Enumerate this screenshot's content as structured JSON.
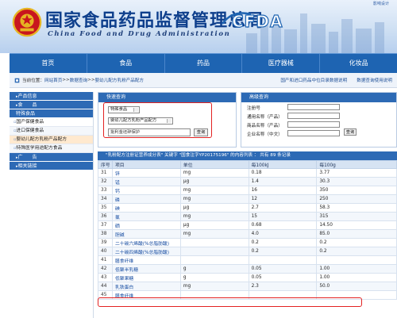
{
  "header": {
    "title_cn": "国家食品药品监督管理总局",
    "title_en": "China Food and Drug Administration",
    "logo_text": "CFDA",
    "top_link": "影响设计"
  },
  "nav": [
    "首页",
    "食品",
    "药品",
    "医疗器械",
    "化妆品"
  ],
  "breadcrumb": {
    "prefix": "当前位置：",
    "items": [
      "网站首页",
      "数据查询",
      "婴幼儿配方乳粉产品配方"
    ],
    "sep": ">>",
    "right_links": [
      "国产和进口药品中位目录数据说明",
      "数据查询使用说明"
    ]
  },
  "sidebar": {
    "sections": [
      {
        "head": "产品信息",
        "arrow": true
      },
      {
        "head": "食　　品",
        "arrow": true
      },
      {
        "head": "特殊食品",
        "arrow": false
      }
    ],
    "items": [
      "国产保健食品",
      "进口保健食品",
      "婴幼儿配方乳粉产品配方",
      "特殊医学用途配方食品"
    ],
    "active_index": 2,
    "bottom_heads": [
      "广　　告",
      "相关链接"
    ]
  },
  "search_panel": {
    "title": "快速查询",
    "select1": "特殊食品",
    "select2": "婴幼儿配方乳粉产品配方",
    "input_value": "批利金坯碎保护",
    "search_button": "查询"
  },
  "advanced_panel": {
    "title": "高级查询",
    "fields": [
      {
        "label": "注册号",
        "value": ""
      },
      {
        "label": "通用名称（产品）",
        "value": ""
      },
      {
        "label": "商品名称（产品）",
        "value": ""
      },
      {
        "label": "企业名称（中文）",
        "value": ""
      }
    ],
    "search_button": "查询"
  },
  "results": {
    "title": "\"乳粉配方注册证营养成分表\" 关键字 \"国食注字YP20175196\" 的内容列表 ：  共有 89 条记录",
    "columns": [
      "序号",
      "项目",
      "单位",
      "每100kJ",
      "每100g"
    ],
    "rows": [
      {
        "seq": "31",
        "name": "锌",
        "unit": "mg",
        "per_kj": "0.18",
        "per_g": "3.77"
      },
      {
        "seq": "32",
        "name": "锰",
        "unit": "μg",
        "per_kj": "1.4",
        "per_g": "30.3"
      },
      {
        "seq": "33",
        "name": "钙",
        "unit": "mg",
        "per_kj": "16",
        "per_g": "350"
      },
      {
        "seq": "34",
        "name": "磷",
        "unit": "mg",
        "per_kj": "12",
        "per_g": "250"
      },
      {
        "seq": "35",
        "name": "碘",
        "unit": "μg",
        "per_kj": "2.7",
        "per_g": "58.3"
      },
      {
        "seq": "36",
        "name": "氯",
        "unit": "mg",
        "per_kj": "15",
        "per_g": "315"
      },
      {
        "seq": "37",
        "name": "硒",
        "unit": "μg",
        "per_kj": "0.68",
        "per_g": "14.50"
      },
      {
        "seq": "38",
        "name": "胆碱",
        "unit": "mg",
        "per_kj": "4.0",
        "per_g": "85.0"
      },
      {
        "seq": "39",
        "name": "二十碳六烯酸(%总脂肪酸)",
        "unit": "",
        "per_kj": "0.2",
        "per_g": "0.2"
      },
      {
        "seq": "40",
        "name": "二十碳四烯酸(%总脂肪酸)",
        "unit": "",
        "per_kj": "0.2",
        "per_g": "0.2"
      },
      {
        "seq": "41",
        "name": "膳食纤维",
        "unit": "",
        "per_kj": "",
        "per_g": ""
      },
      {
        "seq": "42",
        "name": "低聚半乳糖",
        "unit": "g",
        "per_kj": "0.05",
        "per_g": "1.00"
      },
      {
        "seq": "43",
        "name": "低聚果糖",
        "unit": "g",
        "per_kj": "0.05",
        "per_g": "1.00"
      },
      {
        "seq": "44",
        "name": "乳铁蛋白",
        "unit": "mg",
        "per_kj": "2.3",
        "per_g": "50.0"
      },
      {
        "seq": "45",
        "name": "膳食纤维",
        "unit": "",
        "per_kj": "",
        "per_g": ""
      }
    ]
  },
  "colors": {
    "nav_blue": "#1e64b2",
    "panel_blue": "#2d6ab5",
    "highlight_red": "#e32222",
    "active_item": "#ffe9cf"
  }
}
